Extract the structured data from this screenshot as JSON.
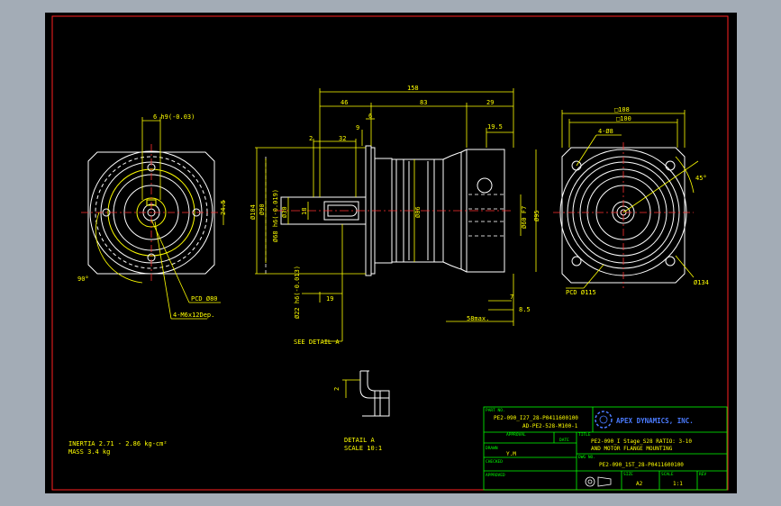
{
  "colors": {
    "background": "#a3acb6",
    "canvas": "#000000",
    "frame": "#ff2020",
    "drawing": "#ffffff",
    "dimension": "#ffff00",
    "centerline": "#ff3030",
    "titleblock": "#00ff00",
    "logo": "#4b7bff"
  },
  "front_view": {
    "dim_keyway": "6 h9(-0.03)",
    "dim_height": "24.5",
    "angle": "90°",
    "pcd": "PCD Ø80",
    "holes": "4-M6x12Dep."
  },
  "side_view": {
    "overall_length": "158",
    "seg_46": "46",
    "seg_83": "83",
    "seg_29": "29",
    "dim_6": "6",
    "dim_19_5": "19.5",
    "dim_2": "2",
    "dim_32": "32",
    "dim_9": "9",
    "dia_104": "Ø104",
    "dia_90": "Ø90",
    "dia_68": "Ø68 h6(-0.019)",
    "dia_30": "Ø30",
    "dia_18": "18",
    "dia_86": "Ø86",
    "dia_60": "Ø60 F7",
    "dia_95": "Ø95",
    "dia_22": "Ø22 h6(-0.013)",
    "dim_19": "19",
    "dim_7": "7",
    "dim_8_5": "8.5",
    "dim_58max": "58max.",
    "see_detail": "SEE DETAIL A"
  },
  "rear_view": {
    "dim_108": "□108",
    "dim_100": "□100",
    "holes": "4-Ø8",
    "angle": "45°",
    "pcd": "PCD Ø115",
    "dia_134": "Ø134"
  },
  "detail": {
    "dim": "2",
    "title": "DETAIL A",
    "scale": "SCALE 10:1"
  },
  "notes": {
    "inertia": "INERTIA 2.71 - 2.86 kg-cm²",
    "mass": "MASS 3.4  kg"
  },
  "title_block": {
    "part_no_label": "PART NO.",
    "part_no_1": "PE2-090_I27_28-P0411600100",
    "part_no_2": "AD-PE2-528-M100-1",
    "company": "APEX DYNAMICS, INC.",
    "approval_label": "APPROVAL",
    "date_label": "DATE",
    "title_label": "TITLE",
    "title_1": "PE2-090_I Stage_S28   RATIO: 3-10",
    "title_2": "AND MOTOR FLANGE MOUNTING",
    "drawn_label": "DRAWN",
    "drawn_value": "Y.M",
    "checked_label": "CHECKED",
    "dwg_no_label": "DWG NO.",
    "dwg_no_value": "PE2-090_1ST_28-P0411600100",
    "approved_label": "APPROVED",
    "size_label": "SIZE",
    "size_value": "A2",
    "scale_label": "SCALE",
    "scale_value": "1:1",
    "rev_label": "REV"
  }
}
